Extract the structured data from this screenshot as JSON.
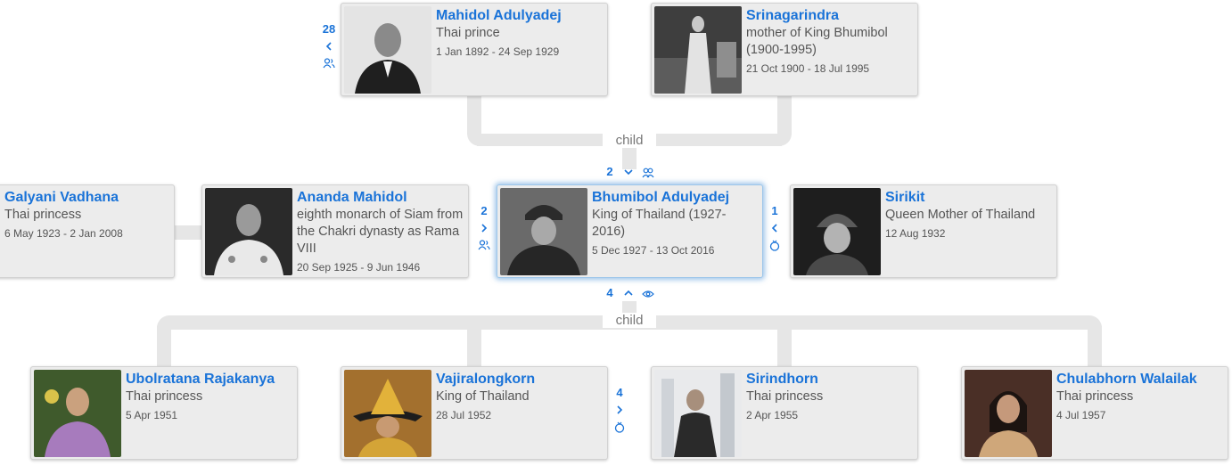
{
  "tree": {
    "link_label_top": "child",
    "link_label_bottom": "child",
    "parents": [
      {
        "name": "Mahidol Adulyadej",
        "desc": "Thai prince",
        "dates": "1 Jan 1892 - 24 Sep 1929"
      },
      {
        "name": "Srinagarindra",
        "desc": "mother of King Bhumibol (1900-1995)",
        "dates": "21 Oct 1900 - 18 Jul 1995"
      }
    ],
    "row": [
      {
        "name": "Galyani Vadhana",
        "desc": "Thai princess",
        "dates": "6 May 1923 - 2 Jan 2008"
      },
      {
        "name": "Ananda Mahidol",
        "desc": "eighth monarch of Siam from the Chakri dynasty as Rama VIII",
        "dates": "20 Sep 1925 - 9 Jun 1946"
      },
      {
        "name": "Bhumibol Adulyadej",
        "desc": "King of Thailand (1927-2016)",
        "dates": "5 Dec 1927 - 13 Oct 2016"
      },
      {
        "name": "Sirikit",
        "desc": "Queen Mother of Thailand",
        "dates": "12 Aug 1932"
      }
    ],
    "children": [
      {
        "name": "Ubolratana Rajakanya",
        "desc": "Thai princess",
        "dates": "5 Apr 1951"
      },
      {
        "name": "Vajiralongkorn",
        "desc": "King of Thailand",
        "dates": "28 Jul 1952"
      },
      {
        "name": "Sirindhorn",
        "desc": "Thai princess",
        "dates": "2 Apr 1955"
      },
      {
        "name": "Chulabhorn Walailak",
        "desc": "Thai princess",
        "dates": "4 Jul 1957"
      }
    ],
    "counts": {
      "mahidol_ancestors": "28",
      "focus_parents": "2",
      "ananda_siblings": "2",
      "sirikit_spouses": "1",
      "focus_children": "4",
      "vajiralongkorn_spouses": "4"
    },
    "colors": {
      "accent": "#1a73d8",
      "connector": "#e6e6e6",
      "card": "#ececec"
    }
  }
}
